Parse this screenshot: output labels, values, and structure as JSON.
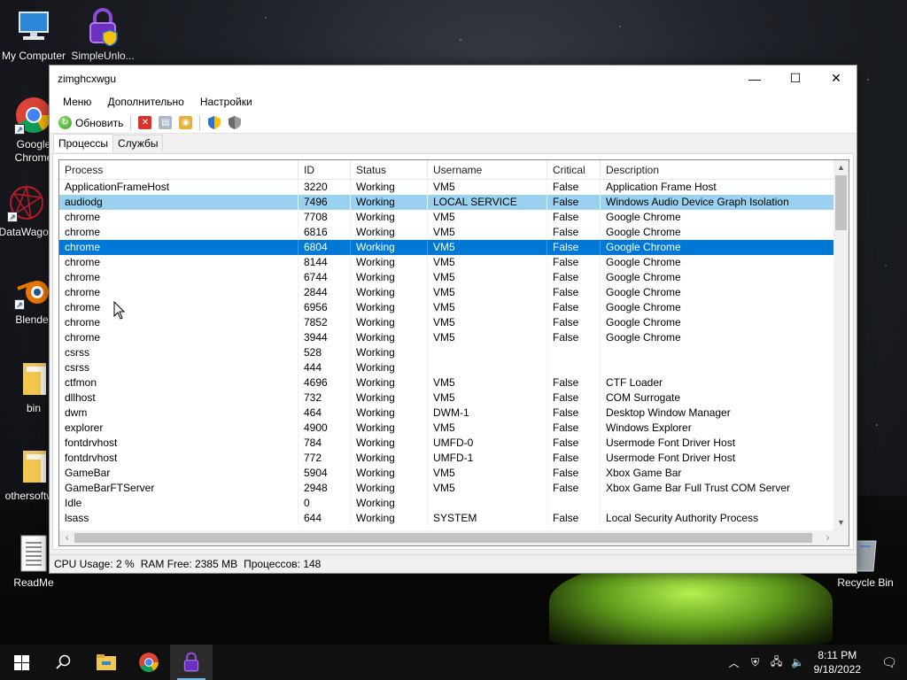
{
  "desktop": {
    "icons": [
      {
        "label": "My Computer"
      },
      {
        "label": "SimpleUnlo..."
      },
      {
        "label": "Google Chrome"
      },
      {
        "label": "DataWagon"
      },
      {
        "label": "Blender"
      },
      {
        "label": "bin"
      },
      {
        "label": "othersoftw..."
      },
      {
        "label": "ReadMe"
      },
      {
        "label": "Recycle Bin"
      }
    ]
  },
  "window": {
    "title": "zimghcxwgu",
    "controls": {
      "minimize": "—",
      "maximize": "☐",
      "close": "✕"
    },
    "menu": [
      "Меню",
      "Дополнительно",
      "Настройки"
    ],
    "toolbar": {
      "refresh_label": "Обновить"
    },
    "tabs": [
      {
        "label": "Процессы",
        "active": true
      },
      {
        "label": "Службы",
        "active": false
      }
    ],
    "columns": [
      "Process",
      "ID",
      "Status",
      "Username",
      "Critical",
      "Description"
    ],
    "rows": [
      {
        "process": "ApplicationFrameHost",
        "id": "3220",
        "status": "Working",
        "user": "VM5",
        "critical": "False",
        "desc": "Application Frame Host"
      },
      {
        "process": "audiodg",
        "id": "7496",
        "status": "Working",
        "user": "LOCAL SERVICE",
        "critical": "False",
        "desc": "Windows Audio Device Graph Isolation",
        "state": "sel-light"
      },
      {
        "process": "chrome",
        "id": "7708",
        "status": "Working",
        "user": "VM5",
        "critical": "False",
        "desc": "Google Chrome"
      },
      {
        "process": "chrome",
        "id": "6816",
        "status": "Working",
        "user": "VM5",
        "critical": "False",
        "desc": "Google Chrome"
      },
      {
        "process": "chrome",
        "id": "6804",
        "status": "Working",
        "user": "VM5",
        "critical": "False",
        "desc": "Google Chrome",
        "state": "sel"
      },
      {
        "process": "chrome",
        "id": "8144",
        "status": "Working",
        "user": "VM5",
        "critical": "False",
        "desc": "Google Chrome"
      },
      {
        "process": "chrome",
        "id": "6744",
        "status": "Working",
        "user": "VM5",
        "critical": "False",
        "desc": "Google Chrome"
      },
      {
        "process": "chrome",
        "id": "2844",
        "status": "Working",
        "user": "VM5",
        "critical": "False",
        "desc": "Google Chrome"
      },
      {
        "process": "chrome",
        "id": "6956",
        "status": "Working",
        "user": "VM5",
        "critical": "False",
        "desc": "Google Chrome"
      },
      {
        "process": "chrome",
        "id": "7852",
        "status": "Working",
        "user": "VM5",
        "critical": "False",
        "desc": "Google Chrome"
      },
      {
        "process": "chrome",
        "id": "3944",
        "status": "Working",
        "user": "VM5",
        "critical": "False",
        "desc": "Google Chrome"
      },
      {
        "process": "csrss",
        "id": "528",
        "status": "Working",
        "user": "",
        "critical": "",
        "desc": ""
      },
      {
        "process": "csrss",
        "id": "444",
        "status": "Working",
        "user": "",
        "critical": "",
        "desc": ""
      },
      {
        "process": "ctfmon",
        "id": "4696",
        "status": "Working",
        "user": "VM5",
        "critical": "False",
        "desc": "CTF Loader"
      },
      {
        "process": "dllhost",
        "id": "732",
        "status": "Working",
        "user": "VM5",
        "critical": "False",
        "desc": "COM Surrogate"
      },
      {
        "process": "dwm",
        "id": "464",
        "status": "Working",
        "user": "DWM-1",
        "critical": "False",
        "desc": "Desktop Window Manager"
      },
      {
        "process": "explorer",
        "id": "4900",
        "status": "Working",
        "user": "VM5",
        "critical": "False",
        "desc": "Windows Explorer"
      },
      {
        "process": "fontdrvhost",
        "id": "784",
        "status": "Working",
        "user": "UMFD-0",
        "critical": "False",
        "desc": "Usermode Font Driver Host"
      },
      {
        "process": "fontdrvhost",
        "id": "772",
        "status": "Working",
        "user": "UMFD-1",
        "critical": "False",
        "desc": "Usermode Font Driver Host"
      },
      {
        "process": "GameBar",
        "id": "5904",
        "status": "Working",
        "user": "VM5",
        "critical": "False",
        "desc": "Xbox Game Bar"
      },
      {
        "process": "GameBarFTServer",
        "id": "2948",
        "status": "Working",
        "user": "VM5",
        "critical": "False",
        "desc": "Xbox Game Bar Full Trust COM Server"
      },
      {
        "process": "Idle",
        "id": "0",
        "status": "Working",
        "user": "",
        "critical": "",
        "desc": ""
      },
      {
        "process": "lsass",
        "id": "644",
        "status": "Working",
        "user": "SYSTEM",
        "critical": "False",
        "desc": "Local Security Authority Process"
      }
    ],
    "status": {
      "cpu": "CPU Usage: 2 %",
      "ram": "RAM Free: 2385 MB",
      "processes": "Процессов: 148"
    }
  },
  "taskbar": {
    "time": "8:11 PM",
    "date": "9/18/2022"
  },
  "colors": {
    "selection": "#0078d7",
    "selection_inactive": "#99d1ef",
    "taskbar": "#101010"
  }
}
